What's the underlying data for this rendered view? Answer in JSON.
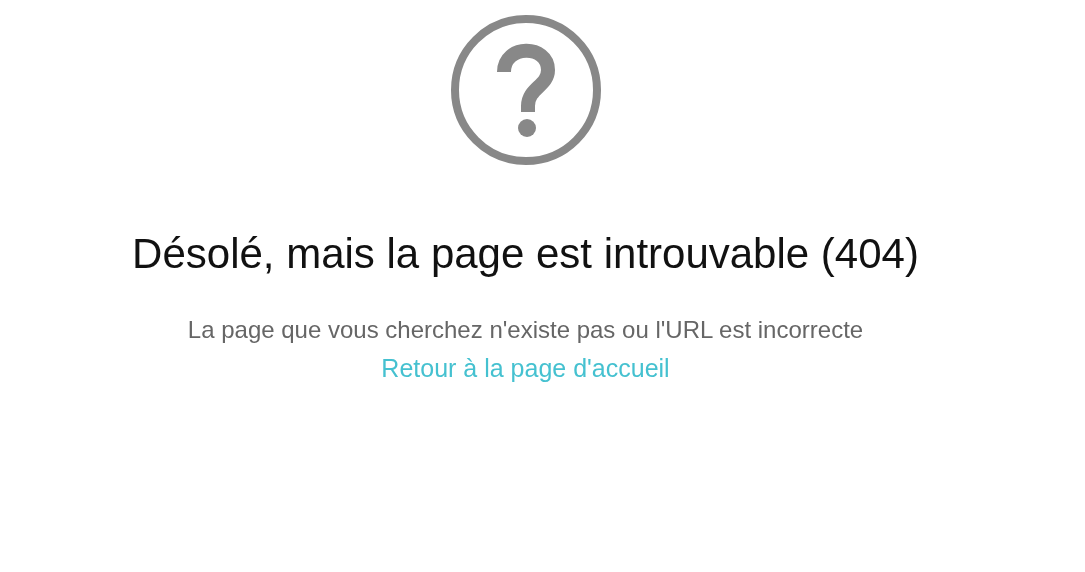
{
  "title": "Désolé, mais la page est introuvable (404)",
  "message": "La page que vous cherchez n'existe pas ou l'URL est incorrecte",
  "link": "Retour à la page d'accueil"
}
